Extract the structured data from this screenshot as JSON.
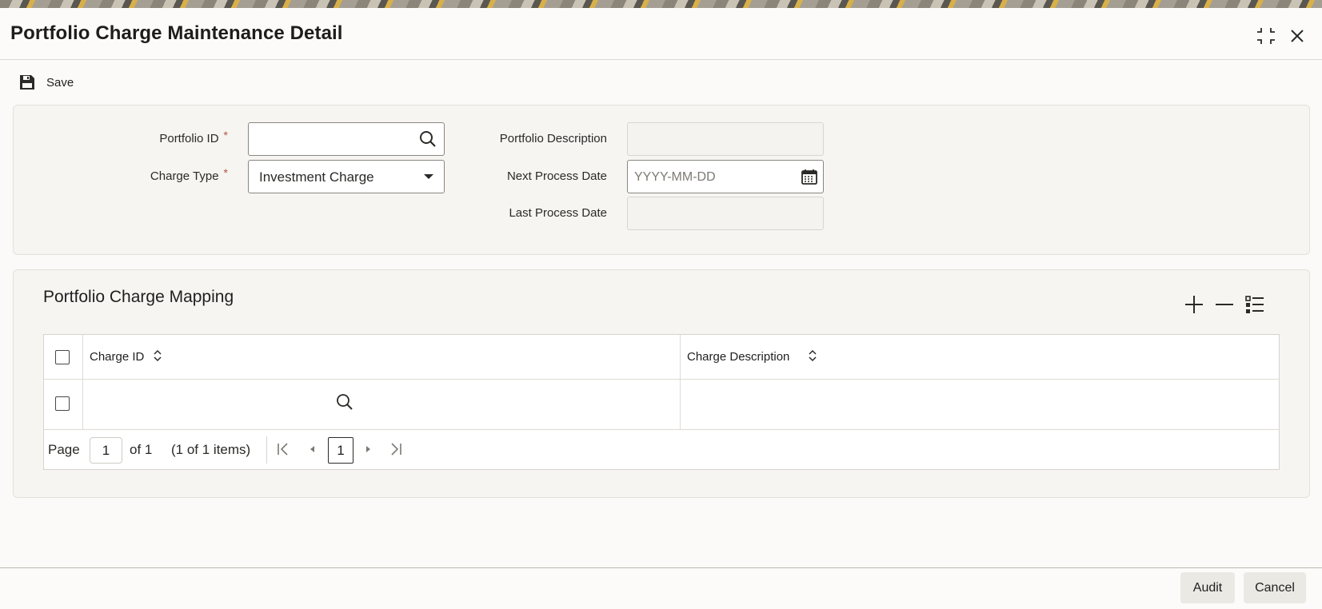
{
  "window": {
    "title": "Portfolio Charge Maintenance Detail",
    "maximize_icon": "maximize-icon",
    "close_icon": "close-icon"
  },
  "toolbar": {
    "save_label": "Save",
    "save_icon": "floppy-disk-icon"
  },
  "form": {
    "portfolio_id": {
      "label": "Portfolio ID",
      "required_mark": "*",
      "value": ""
    },
    "charge_type": {
      "label": "Charge Type",
      "required_mark": "*",
      "value": "Investment Charge"
    },
    "portfolio_description": {
      "label": "Portfolio Description",
      "value": ""
    },
    "next_process_date": {
      "label": "Next Process Date",
      "placeholder": "YYYY-MM-DD",
      "value": ""
    },
    "last_process_date": {
      "label": "Last Process Date",
      "value": ""
    }
  },
  "mapping": {
    "title": "Portfolio Charge Mapping",
    "actions": [
      "add-icon",
      "remove-icon",
      "single-record-view-icon"
    ],
    "columns": [
      "Charge ID",
      "Charge Description"
    ],
    "rows": [
      {
        "charge_id": "",
        "charge_description": ""
      }
    ],
    "pager": {
      "page_label": "Page",
      "page_value": "1",
      "of_text": "of 1",
      "items_text": "(1 of 1 items)",
      "current_page": "1"
    }
  },
  "footer": {
    "audit_label": "Audit",
    "cancel_label": "Cancel"
  },
  "colors": {
    "title_text": "#1d1d1b",
    "panel_bg": "#f6f5f2",
    "required_mark": "#b0543a"
  }
}
